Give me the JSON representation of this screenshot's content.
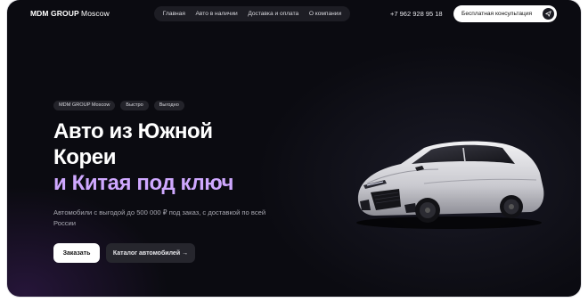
{
  "header": {
    "logo_brand": "MDM GROUP",
    "logo_city": "Moscow",
    "nav": [
      "Главная",
      "Авто в наличии",
      "Доставка и оплата",
      "О компании"
    ],
    "phone": "+7 962 928 95 18",
    "consult_label": "Бесплатная консультация",
    "consult_icon": "send-icon"
  },
  "hero": {
    "tags": [
      "MDM GROUP Moscow",
      "Быстро",
      "Выгодно"
    ],
    "headline_line1": "Авто из Южной",
    "headline_line2": "Кореи",
    "headline_line3": "и Китая под ключ",
    "headline_accent_color": "#cfa8ff",
    "subtitle": "Автомобили с выгодой до 500 000 ₽ под заказ, с доставкой по всей России",
    "order_button": "Заказать",
    "catalog_button": "Каталог автомобилей →"
  },
  "colors": {
    "background": "#0b0b11",
    "nav_bg": "#1d1d24"
  }
}
